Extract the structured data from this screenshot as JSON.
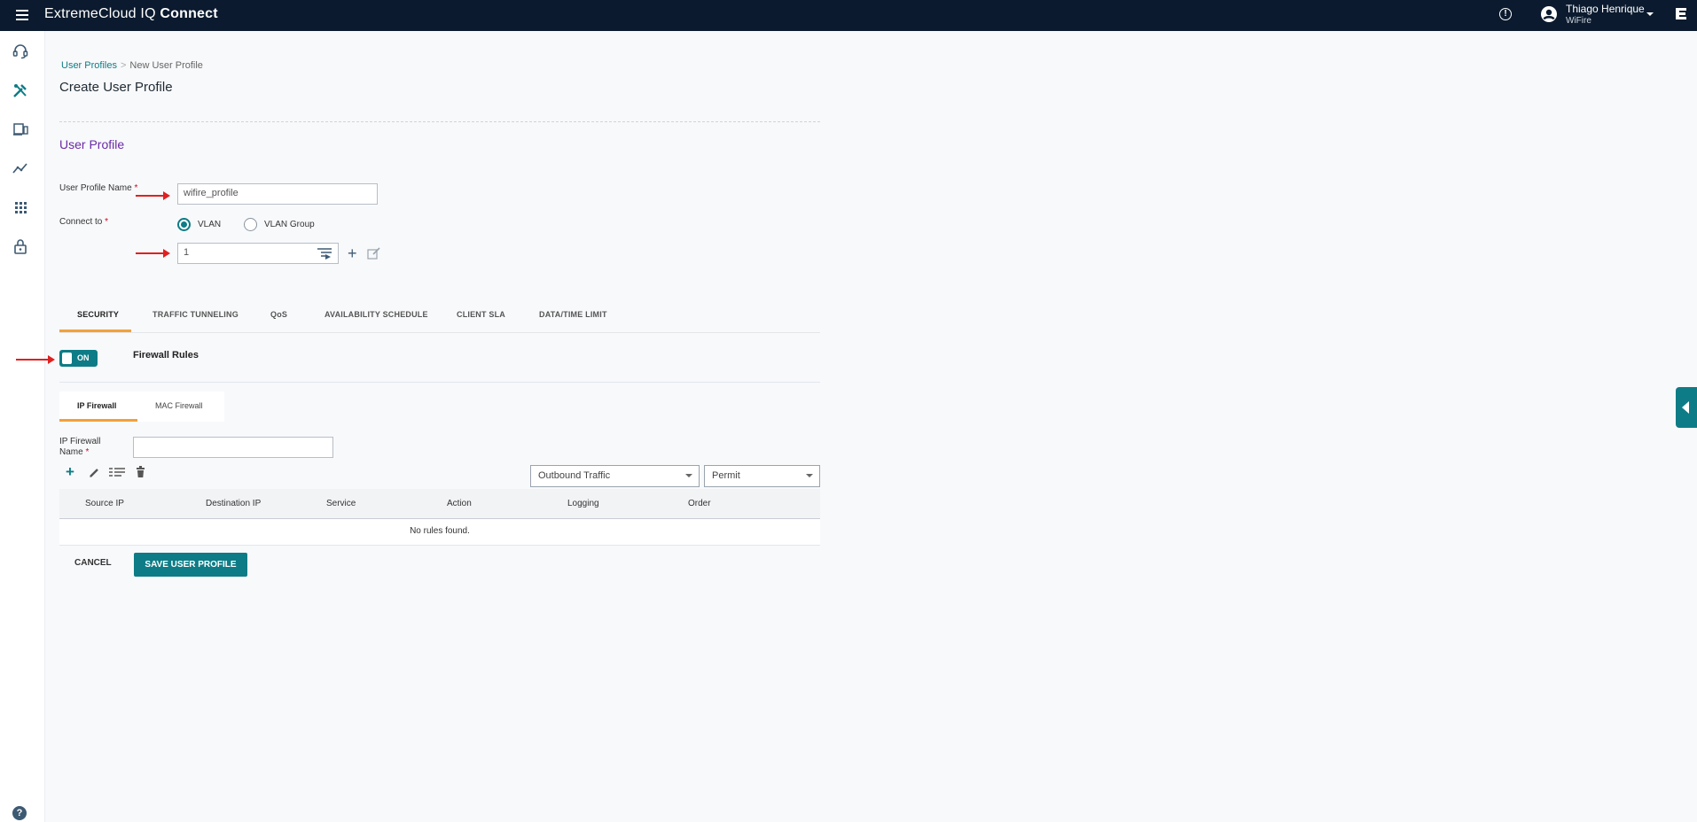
{
  "app": {
    "brand_light": "ExtremeCloud IQ",
    "brand_bold": "Connect",
    "user_name": "Thiago Henrique",
    "user_org": "WiFire"
  },
  "colors": {
    "accent": "#0e7c86",
    "section": "#6a2aa5",
    "tab_active": "#f2a03a",
    "topbar": "#0b1a2e",
    "arrow": "#e02020"
  },
  "breadcrumb": {
    "parent": "User Profiles",
    "sep": ">",
    "current": "New User Profile"
  },
  "page_title": "Create User Profile",
  "section_title": "User Profile",
  "form": {
    "name_label": "User Profile Name",
    "name_value": "wifire_profile",
    "connect_label": "Connect to",
    "required_mark": "*",
    "radio_vlan": "VLAN",
    "radio_vlan_group": "VLAN Group",
    "vlan_value": "1",
    "selected_option": "VLAN"
  },
  "tabs": [
    {
      "label": "SECURITY",
      "active": true
    },
    {
      "label": "TRAFFIC TUNNELING"
    },
    {
      "label": "QoS"
    },
    {
      "label": "AVAILABILITY SCHEDULE"
    },
    {
      "label": "CLIENT SLA"
    },
    {
      "label": "DATA/TIME LIMIT"
    }
  ],
  "firewall": {
    "toggle_text": "ON",
    "title": "Firewall Rules",
    "subtabs": [
      {
        "label": "IP Firewall",
        "active": true
      },
      {
        "label": "MAC Firewall"
      }
    ],
    "name_label_line1": "IP Firewall",
    "name_label_line2": "Name",
    "name_value": "",
    "direction": "Outbound Traffic",
    "action_default": "Permit"
  },
  "table": {
    "columns": [
      "Source IP",
      "Destination IP",
      "Service",
      "Action",
      "Logging",
      "Order"
    ],
    "empty_text": "No rules found."
  },
  "buttons": {
    "cancel": "CANCEL",
    "save": "SAVE USER PROFILE"
  },
  "icons": [
    "menu-icon",
    "info-icon",
    "account-circle-icon",
    "chevron-down-icon",
    "extreme-logo-icon",
    "headset-icon",
    "tools-icon",
    "devices-icon",
    "analytics-icon",
    "apps-grid-icon",
    "lock-icon",
    "help-icon",
    "add-icon",
    "edit-icon",
    "list-icon",
    "delete-icon",
    "collapse-panel-icon"
  ]
}
